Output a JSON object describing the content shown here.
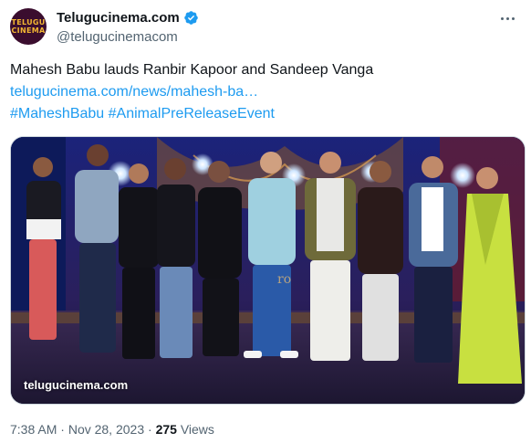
{
  "account": {
    "display_name": "Telugucinema.com",
    "handle": "@telugucinemacom",
    "avatar_text_top": "TELUGU",
    "avatar_text_bottom": "CINEMA",
    "verified": true,
    "verified_color": "#1d9bf0"
  },
  "tweet": {
    "text": "Mahesh Babu lauds Ranbir Kapoor and Sandeep Vanga",
    "link": "telugucinema.com/news/mahesh-ba…",
    "hashtags": "#MaheshBabu #AnimalPreReleaseEvent"
  },
  "media": {
    "watermark": "telugucinema.com"
  },
  "meta": {
    "time": "7:38 AM",
    "sep1": " · ",
    "date": "Nov 28, 2023",
    "sep2": " · ",
    "views_count": "275",
    "views_label": " Views"
  },
  "colors": {
    "link": "#1d9bf0",
    "secondary_text": "#536471",
    "primary_text": "#0f1419"
  },
  "icons": {
    "more": "more-horizontal-icon",
    "verified": "verified-badge-icon"
  }
}
